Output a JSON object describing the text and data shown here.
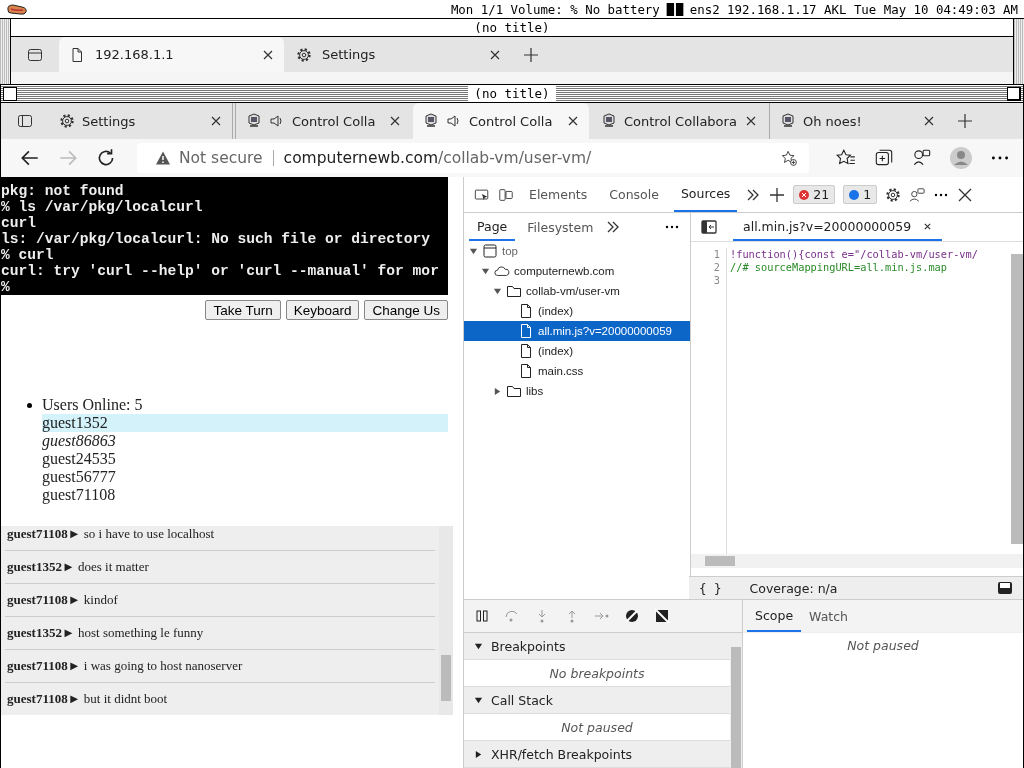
{
  "menubar": {
    "status": "Mon 1/1 Volume: % No battery",
    "clock": "ens2 192.168.1.17 AKL Tue May 10 04:49:03 AM"
  },
  "back_window": {
    "title": "(no title)",
    "tabs": [
      {
        "label": "192.168.1.1",
        "kind": "page",
        "selected": true
      },
      {
        "label": "Settings",
        "kind": "settings",
        "selected": false
      }
    ]
  },
  "window": {
    "title": "(no title)",
    "tabs": [
      {
        "label": "Settings",
        "kind": "settings",
        "audio": false,
        "selected": false
      },
      {
        "label": "Control Colla",
        "kind": "site",
        "audio": true,
        "selected": false
      },
      {
        "label": "Control Colla",
        "kind": "site",
        "audio": true,
        "selected": true
      },
      {
        "label": "Control Collabora",
        "kind": "site",
        "audio": false,
        "selected": false
      },
      {
        "label": "Oh noes!",
        "kind": "site",
        "audio": false,
        "selected": false
      }
    ]
  },
  "address_bar": {
    "security": "Not secure",
    "host": "computernewb.com",
    "path": "/collab-vm/user-vm/"
  },
  "page": {
    "terminal": [
      "pkg: not found",
      "% ls /var/pkg/localcurl",
      "curl",
      "ls: /var/pkg/localcurl: No such file or directory",
      "% curl",
      "curl: try 'curl --help' or 'curl --manual' for mor",
      "%"
    ],
    "buttons": [
      "Take Turn",
      "Keyboard",
      "Change Us"
    ],
    "users": {
      "heading": "Users Online: 5",
      "list": [
        {
          "name": "guest1352",
          "selected": true,
          "emphasized": false
        },
        {
          "name": "guest86863",
          "selected": false,
          "emphasized": true
        },
        {
          "name": "guest24535",
          "selected": false,
          "emphasized": false
        },
        {
          "name": "guest56777",
          "selected": false,
          "emphasized": false
        },
        {
          "name": "guest71108",
          "selected": false,
          "emphasized": false
        }
      ]
    },
    "chat": [
      {
        "text": "**guest71108►** so i have to use localhost"
      },
      {
        "text": "**guest1352►** does it matter"
      },
      {
        "text": "**guest71108►** kindof"
      },
      {
        "text": "**guest1352►** host something le funny"
      },
      {
        "text": "**guest71108►** i was going to host nanoserver"
      },
      {
        "text": "**guest71108►** but it didnt boot"
      }
    ]
  },
  "devtools": {
    "tabs": [
      {
        "label": "Elements",
        "selected": false
      },
      {
        "label": "Console",
        "selected": false
      },
      {
        "label": "Sources",
        "selected": true
      }
    ],
    "errors": "21",
    "messages": "1",
    "navigator": {
      "tabs": [
        {
          "label": "Page",
          "selected": true
        },
        {
          "label": "Filesystem",
          "selected": false
        }
      ],
      "tree": [
        {
          "label": "top",
          "kind": "frame",
          "expanded": true,
          "selected": false,
          "children": [
            {
              "label": "computernewb.com",
              "kind": "domain",
              "expanded": true,
              "selected": false,
              "children": [
                {
                  "label": "collab-vm/user-vm",
                  "kind": "folder",
                  "expanded": true,
                  "selected": false,
                  "children": [
                    {
                      "label": "(index)",
                      "kind": "file",
                      "selected": false
                    },
                    {
                      "label": "all.min.js?v=20000000059",
                      "kind": "file",
                      "selected": true
                    },
                    {
                      "label": "(index)",
                      "kind": "file",
                      "selected": false
                    },
                    {
                      "label": "main.css",
                      "kind": "file",
                      "selected": false
                    }
                  ]
                },
                {
                  "label": "libs",
                  "kind": "folder",
                  "expanded": false,
                  "selected": false
                }
              ]
            }
          ]
        }
      ]
    },
    "editor": {
      "file": "all.min.js?v=20000000059",
      "lines": [
        {
          "number": "1",
          "text": "!function(){const e=\"/collab-vm/user-vm/",
          "kind": "code"
        },
        {
          "number": "2",
          "text": "//# sourceMappingURL=all.min.js.map",
          "kind": "comment"
        },
        {
          "number": "3"
        }
      ]
    },
    "format_button": "{ }",
    "coverage": "Coverage: n/a",
    "debugger": {
      "sections": [
        {
          "title": "Breakpoints",
          "expanded": true,
          "empty": "No breakpoints"
        },
        {
          "title": "Call Stack",
          "expanded": true,
          "empty": "Not paused"
        },
        {
          "title": "XHR/fetch Breakpoints",
          "expanded": false
        }
      ],
      "side_tabs": [
        {
          "label": "Scope",
          "selected": true
        },
        {
          "label": "Watch",
          "selected": false
        }
      ],
      "side_empty": "Not paused"
    }
  }
}
